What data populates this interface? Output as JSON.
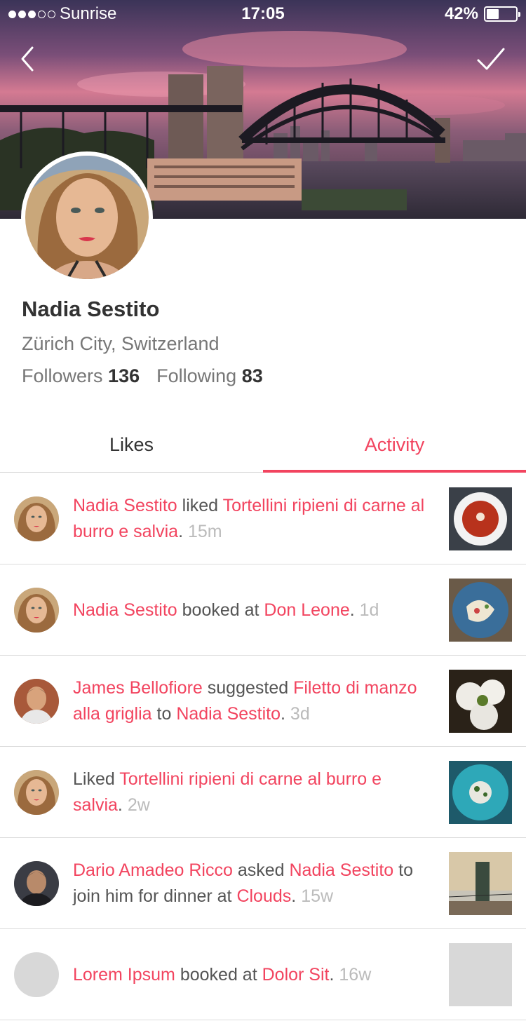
{
  "status_bar": {
    "carrier": "Sunrise",
    "signal_bars_filled": 3,
    "signal_bars_total": 5,
    "time": "17:05",
    "battery_text": "42%",
    "battery_level": 0.42
  },
  "profile": {
    "name": "Nadia Sestito",
    "location": "Zürich City, Switzerland",
    "followers_label": "Followers",
    "followers_count": "136",
    "following_label": "Following",
    "following_count": "83"
  },
  "tabs": [
    {
      "label": "Likes",
      "active": false
    },
    {
      "label": "Activity",
      "active": true
    }
  ],
  "activity": [
    {
      "avatar": "nadia",
      "thumb": "soup-bowl",
      "parts": [
        {
          "t": "Nadia Sestito",
          "link": true
        },
        {
          "t": " liked "
        },
        {
          "t": "Tortellini ripieni di carne al burro e salvia",
          "link": true
        },
        {
          "t": ". "
        },
        {
          "t": "15m",
          "ago": true
        }
      ]
    },
    {
      "avatar": "nadia",
      "thumb": "blue-plate",
      "parts": [
        {
          "t": "Nadia Sestito",
          "link": true
        },
        {
          "t": " booked at "
        },
        {
          "t": "Don Leone",
          "link": true
        },
        {
          "t": ". "
        },
        {
          "t": "1d",
          "ago": true
        }
      ]
    },
    {
      "avatar": "james",
      "thumb": "dumplings",
      "parts": [
        {
          "t": "James Bellofiore",
          "link": true
        },
        {
          "t": " suggested "
        },
        {
          "t": "Filetto di manzo alla griglia",
          "link": true
        },
        {
          "t": " to "
        },
        {
          "t": "Nadia Sestito",
          "link": true
        },
        {
          "t": ". "
        },
        {
          "t": "3d",
          "ago": true
        }
      ]
    },
    {
      "avatar": "nadia",
      "thumb": "teal-plate",
      "parts": [
        {
          "t": "Liked "
        },
        {
          "t": "Tortellini ripieni di carne al burro e salvia",
          "link": true
        },
        {
          "t": ". "
        },
        {
          "t": "2w",
          "ago": true
        }
      ]
    },
    {
      "avatar": "dario",
      "thumb": "tower",
      "parts": [
        {
          "t": "Dario Amadeo Ricco",
          "link": true
        },
        {
          "t": " asked "
        },
        {
          "t": "Nadia Sestito",
          "link": true
        },
        {
          "t": " to join him for dinner at "
        },
        {
          "t": "Clouds",
          "link": true
        },
        {
          "t": ". "
        },
        {
          "t": "15w",
          "ago": true
        }
      ]
    },
    {
      "avatar": "placeholder",
      "thumb": "placeholder",
      "parts": [
        {
          "t": "Lorem Ipsum",
          "link": true
        },
        {
          "t": " booked at "
        },
        {
          "t": "Dolor Sit",
          "link": true
        },
        {
          "t": ". "
        },
        {
          "t": "16w",
          "ago": true
        }
      ]
    }
  ],
  "icons": {
    "back": "chevron-left-icon",
    "confirm": "checkmark-icon"
  },
  "colors": {
    "accent": "#f2445f",
    "text": "#333333",
    "muted": "#777777",
    "timestamp": "#bbbbbb"
  }
}
